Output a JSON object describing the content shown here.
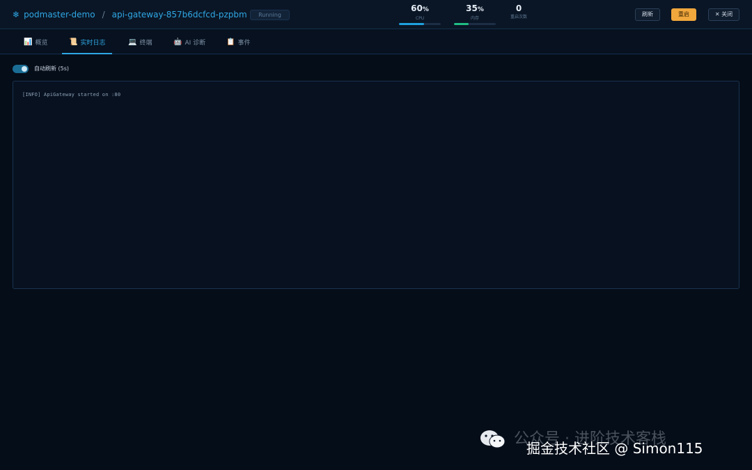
{
  "header": {
    "project": "podmaster-demo",
    "separator": "/",
    "pod": "api-gateway-857b6dcfcd-pzpbm",
    "status": "Running",
    "metrics": [
      {
        "value": "60",
        "unit": "%",
        "label": "CPU",
        "fill": 0.6,
        "color": "#1fa2e0"
      },
      {
        "value": "35",
        "unit": "%",
        "label": "内存",
        "fill": 0.35,
        "color": "#1fbf84"
      },
      {
        "value": "0",
        "unit": "",
        "label": "重启次数"
      }
    ],
    "buttons": {
      "refresh": "刷新",
      "restart": "重启",
      "close": "✕ 关闭"
    }
  },
  "tabs": [
    {
      "icon": "📊",
      "label": "概览"
    },
    {
      "icon": "📜",
      "label": "实时日志"
    },
    {
      "icon": "💻",
      "label": "终端"
    },
    {
      "icon": "🤖",
      "label": "AI 诊断"
    },
    {
      "icon": "📋",
      "label": "事件"
    }
  ],
  "active_tab": 1,
  "auto_refresh": {
    "label": "自动刷新 (5s)",
    "on": true
  },
  "logs": [
    "[INFO] ApiGateway started on :80"
  ],
  "watermark": {
    "line1": "公众号 · 进阶技术客栈",
    "line2": "掘金技术社区 @ Simon115"
  },
  "colors": {
    "accent": "#2fa7e4",
    "restart": "#f0a73c",
    "background": "#050d18"
  }
}
